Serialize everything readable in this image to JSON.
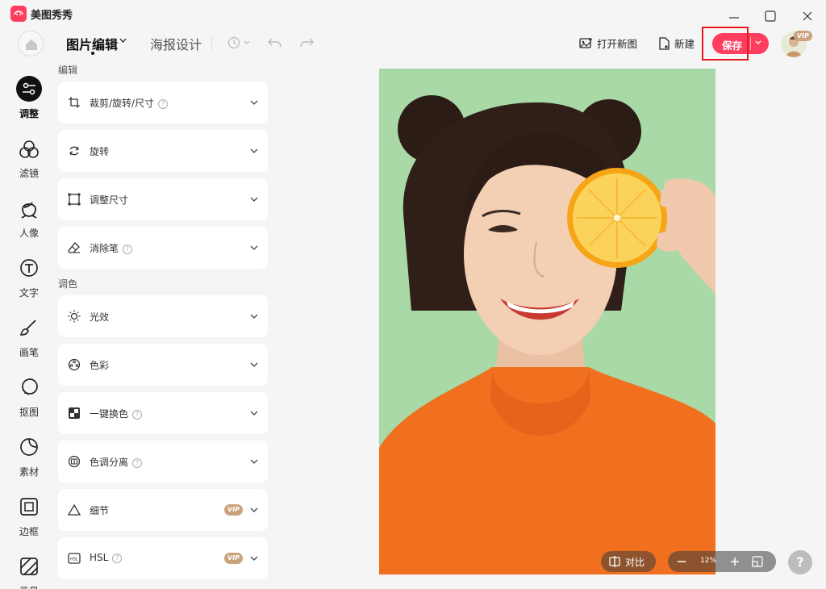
{
  "app": {
    "name": "美图秀秀"
  },
  "tabs": {
    "active": "图片编辑",
    "inactive": "海报设计"
  },
  "actions": {
    "open_new": "打开新图",
    "new": "新建",
    "save": "保存",
    "vip": "VIP"
  },
  "nav": [
    {
      "label": "调整",
      "icon": "sliders-icon",
      "active": true
    },
    {
      "label": "滤镜",
      "icon": "filter-circles-icon"
    },
    {
      "label": "人像",
      "icon": "portrait-icon"
    },
    {
      "label": "文字",
      "icon": "text-t-icon"
    },
    {
      "label": "画笔",
      "icon": "brush-icon"
    },
    {
      "label": "抠图",
      "icon": "cutout-icon"
    },
    {
      "label": "素材",
      "icon": "sticker-icon"
    },
    {
      "label": "边框",
      "icon": "frame-icon"
    },
    {
      "label": "背景",
      "icon": "background-icon"
    }
  ],
  "panel": {
    "section_edit": "编辑",
    "section_tone": "调色",
    "items": [
      {
        "label": "裁剪/旋转/尺寸",
        "icon": "crop-icon",
        "help": true
      },
      {
        "label": "旋转",
        "icon": "rotate-icon"
      },
      {
        "label": "调整尺寸",
        "icon": "resize-icon"
      },
      {
        "label": "消除笔",
        "icon": "eraser-icon",
        "help": true
      },
      {
        "label": "光效",
        "icon": "light-sun-icon"
      },
      {
        "label": "色彩",
        "icon": "palette-icon"
      },
      {
        "label": "一键换色",
        "icon": "color-swap-icon",
        "help": true
      },
      {
        "label": "色调分离",
        "icon": "split-tone-icon",
        "help": true
      },
      {
        "label": "细节",
        "icon": "triangle-detail-icon",
        "vip": "VIP"
      },
      {
        "label": "HSL",
        "icon": "hsl-icon",
        "help": true,
        "vip": "VIP"
      }
    ]
  },
  "canvas": {
    "compare_label": "对比",
    "zoom": "12%"
  },
  "help_label": "?",
  "colors": {
    "accent": "#ff3e5f",
    "highlight": "#e5181e",
    "vip": "#caa27c",
    "photo_bg": "#a9d9a6",
    "sweater": "#f0701f",
    "orange": "#f8b21f"
  }
}
